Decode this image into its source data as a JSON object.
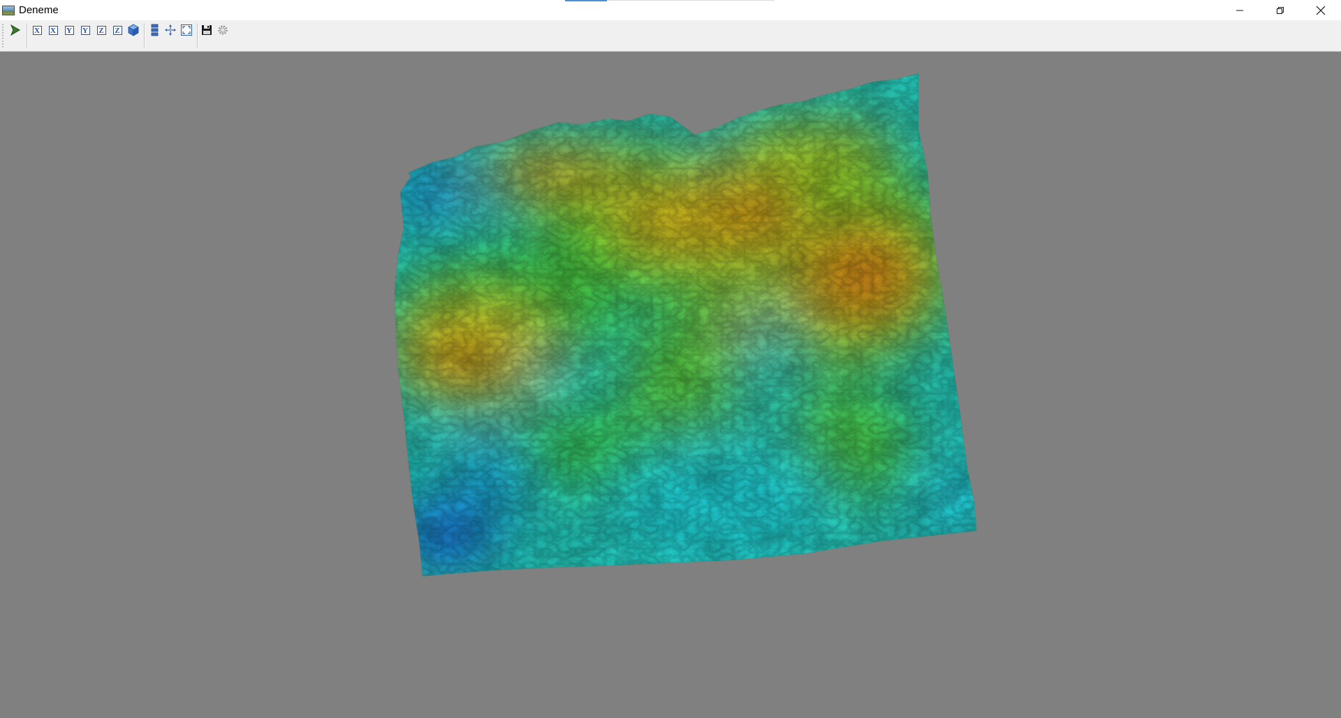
{
  "window": {
    "title": "Deneme",
    "icon": "app-image-icon",
    "controls": {
      "minimize_icon": "minimize-icon",
      "restore_icon": "restore-icon",
      "close_icon": "close-icon"
    }
  },
  "toolbar": {
    "buttons": [
      {
        "name": "select-pointer-button",
        "icon": "arrow-pointer-icon"
      },
      {
        "name": "view-x-positive-button",
        "label": "X",
        "icon": "axis-x-icon"
      },
      {
        "name": "view-x-negative-button",
        "label": "X",
        "icon": "axis-x-icon"
      },
      {
        "name": "view-y-positive-button",
        "label": "Y",
        "icon": "axis-y-icon"
      },
      {
        "name": "view-y-negative-button",
        "label": "Y",
        "icon": "axis-y-icon"
      },
      {
        "name": "view-z-positive-button",
        "label": "Z",
        "icon": "axis-z-icon"
      },
      {
        "name": "view-z-negative-button",
        "label": "Z",
        "icon": "axis-z-icon"
      },
      {
        "name": "view-3d-button",
        "icon": "cube-icon"
      },
      {
        "name": "layers-button",
        "icon": "layers-icon"
      },
      {
        "name": "move-button",
        "icon": "move-arrows-icon"
      },
      {
        "name": "fit-view-button",
        "icon": "fit-to-window-icon"
      },
      {
        "name": "save-button",
        "icon": "floppy-disk-icon"
      },
      {
        "name": "settings-button",
        "icon": "gear-icon"
      }
    ]
  },
  "viewport": {
    "background_color": "#808080",
    "content": "3d-terrain-surface",
    "colormap": [
      "#0022dd",
      "#00e5ee",
      "#00e030",
      "#e6d800",
      "#e35a00"
    ]
  }
}
